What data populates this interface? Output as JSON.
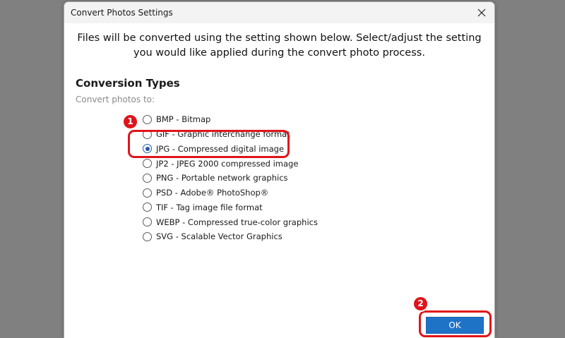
{
  "window": {
    "title": "Convert Photos Settings",
    "close_glyph": "✕"
  },
  "description": "Files will be converted using the setting shown below. Select/adjust the setting you would like applied during the convert photo process.",
  "section": {
    "heading": "Conversion Types",
    "subheading": "Convert photos to:"
  },
  "options": [
    {
      "label": "BMP - Bitmap",
      "checked": false
    },
    {
      "label": "GIF - Graphic interchange format",
      "checked": false
    },
    {
      "label": "JPG - Compressed digital image",
      "checked": true
    },
    {
      "label": "JP2 - JPEG 2000 compressed image",
      "checked": false
    },
    {
      "label": "PNG - Portable network graphics",
      "checked": false
    },
    {
      "label": "PSD - Adobe® PhotoShop®",
      "checked": false
    },
    {
      "label": "TIF - Tag image file format",
      "checked": false
    },
    {
      "label": "WEBP - Compressed true-color graphics",
      "checked": false
    },
    {
      "label": "SVG - Scalable Vector Graphics",
      "checked": false
    }
  ],
  "buttons": {
    "ok_label": "OK"
  },
  "annotations": {
    "step1": "1",
    "step2": "2",
    "color": "#e0141b"
  },
  "colors": {
    "accent": "#1f73c7",
    "backdrop": "#808080"
  }
}
